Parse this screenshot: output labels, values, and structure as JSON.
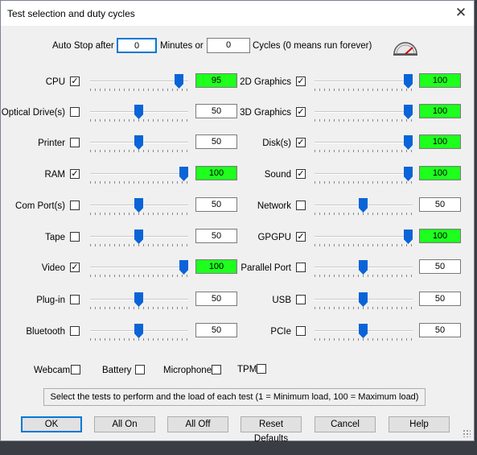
{
  "window": {
    "title": "Test selection and duty cycles",
    "close_glyph": "✕"
  },
  "autostop": {
    "label": "Auto Stop after",
    "minutes_value": "0",
    "minutes_label": "Minutes or",
    "cycles_value": "0",
    "cycles_label": "Cycles (0 means run forever)"
  },
  "left_tests": [
    {
      "label": "CPU",
      "checked": true,
      "load": 95
    },
    {
      "label": "Optical Drive(s)",
      "checked": false,
      "load": 50
    },
    {
      "label": "Printer",
      "checked": false,
      "load": 50
    },
    {
      "label": "RAM",
      "checked": true,
      "load": 100
    },
    {
      "label": "Com Port(s)",
      "checked": false,
      "load": 50
    },
    {
      "label": "Tape",
      "checked": false,
      "load": 50
    },
    {
      "label": "Video",
      "checked": true,
      "load": 100
    },
    {
      "label": "Plug-in",
      "checked": false,
      "load": 50
    },
    {
      "label": "Bluetooth",
      "checked": false,
      "load": 50
    }
  ],
  "right_tests": [
    {
      "label": "2D Graphics",
      "checked": true,
      "load": 100
    },
    {
      "label": "3D Graphics",
      "checked": true,
      "load": 100
    },
    {
      "label": "Disk(s)",
      "checked": true,
      "load": 100
    },
    {
      "label": "Sound",
      "checked": true,
      "load": 100
    },
    {
      "label": "Network",
      "checked": false,
      "load": 50
    },
    {
      "label": "GPGPU",
      "checked": true,
      "load": 100
    },
    {
      "label": "Parallel Port",
      "checked": false,
      "load": 50
    },
    {
      "label": "USB",
      "checked": false,
      "load": 50
    },
    {
      "label": "PCIe",
      "checked": false,
      "load": 50
    }
  ],
  "extra_tests": [
    {
      "label": "Webcam",
      "checked": false
    },
    {
      "label": "Battery",
      "checked": false
    },
    {
      "label": "Microphone",
      "checked": false
    },
    {
      "label": "TPM",
      "checked": false
    }
  ],
  "status": "Select the tests to perform and the load of each test (1 = Minimum load, 100 = Maximum load)",
  "buttons": {
    "ok": "OK",
    "all_on": "All On",
    "all_off": "All Off",
    "reset_defaults": "Reset Defaults",
    "cancel": "Cancel",
    "help": "Help"
  },
  "colors": {
    "active_load": "#1eff1e",
    "slider_thumb": "#0a64d8"
  },
  "icons": {
    "gauge": "speedometer-icon",
    "checked_glyph": "✓"
  }
}
